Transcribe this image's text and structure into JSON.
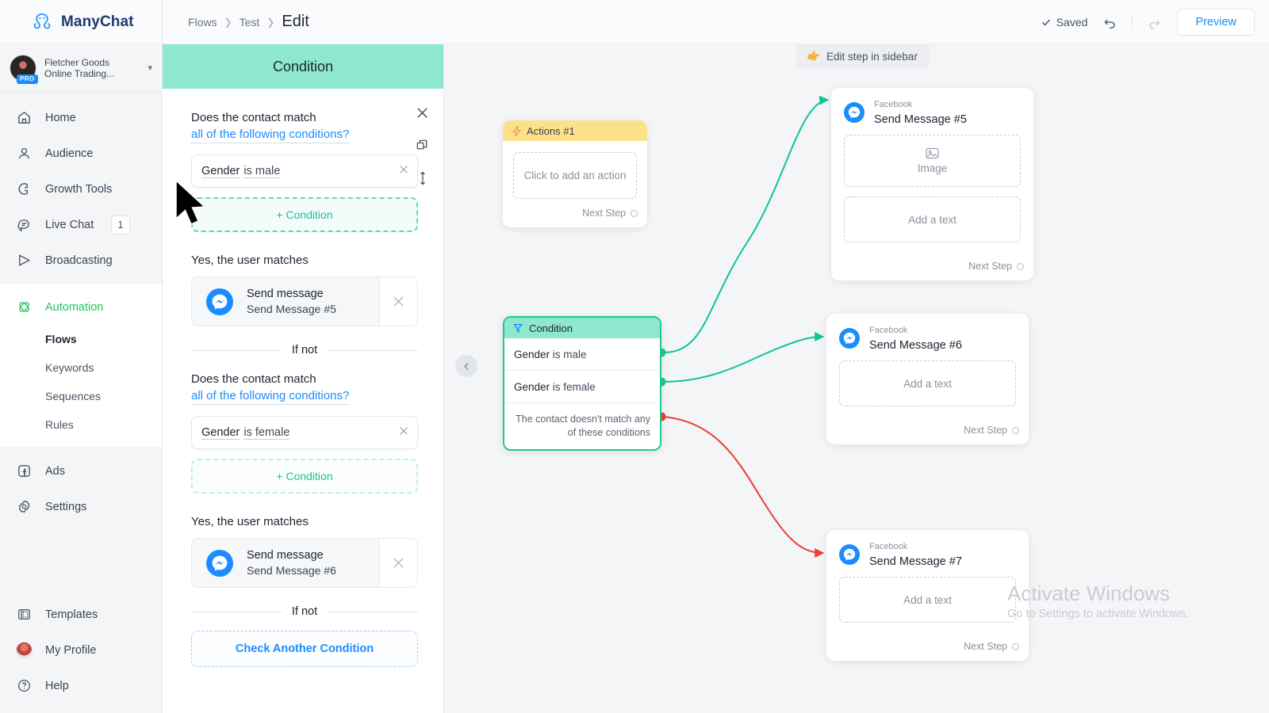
{
  "brand": {
    "name": "ManyChat",
    "logo_icon": "octopus-icon",
    "accent_blue": "#1a8cff",
    "accent_green": "#22c55e",
    "accent_teal": "#17c39a",
    "header_teal": "#8ee8cf",
    "red": "#e8413a"
  },
  "account": {
    "name": "Fletcher Goods",
    "subtitle": "Online Trading...",
    "badge": "PRO",
    "chevron_icon": "chevron-down-icon"
  },
  "sidebar": {
    "items": [
      {
        "label": "Home",
        "icon": "home-icon"
      },
      {
        "label": "Audience",
        "icon": "user-icon"
      },
      {
        "label": "Growth Tools",
        "icon": "magnet-icon"
      },
      {
        "label": "Live Chat",
        "icon": "chat-bubble-icon",
        "badge": "1"
      },
      {
        "label": "Broadcasting",
        "icon": "send-icon"
      }
    ],
    "automation": {
      "label": "Automation",
      "icon": "atom-icon"
    },
    "automation_sub": [
      {
        "label": "Flows",
        "active": true
      },
      {
        "label": "Keywords",
        "active": false
      },
      {
        "label": "Sequences",
        "active": false
      },
      {
        "label": "Rules",
        "active": false
      }
    ],
    "lower": [
      {
        "label": "Ads",
        "icon": "facebook-square-icon"
      },
      {
        "label": "Settings",
        "icon": "gear-icon"
      }
    ],
    "bottom": [
      {
        "label": "Templates",
        "icon": "templates-icon"
      },
      {
        "label": "My Profile",
        "icon": "profile-avatar-icon"
      },
      {
        "label": "Help",
        "icon": "question-circle-icon"
      }
    ]
  },
  "topbar": {
    "breadcrumbs": [
      {
        "label": "Flows"
      },
      {
        "label": "Test"
      }
    ],
    "current": "Edit",
    "saved_label": "Saved",
    "saved_icon": "checkmark-icon",
    "undo_icon": "undo-arrow-icon",
    "redo_icon": "redo-arrow-icon",
    "preview_label": "Preview"
  },
  "panel": {
    "title": "Condition",
    "tools": {
      "close_icon": "close-icon",
      "duplicate_icon": "duplicate-icon",
      "reorder_icon": "move-updown-icon"
    },
    "blocks": [
      {
        "question_line1": "Does the contact match",
        "question_line2": "all of the following conditions?",
        "condition": {
          "field": "Gender",
          "value": "is male",
          "remove_icon": "close-icon"
        },
        "add_condition_label": "+ Condition",
        "yes_label": "Yes, the user matches",
        "action": {
          "title": "Send message",
          "subtitle": "Send Message #5",
          "icon": "messenger-icon",
          "remove_icon": "close-icon"
        },
        "if_not_label": "If not"
      },
      {
        "question_line1": "Does the contact match",
        "question_line2": "all of the following conditions?",
        "condition": {
          "field": "Gender",
          "value": "is female",
          "remove_icon": "close-icon"
        },
        "add_condition_label": "+ Condition",
        "yes_label": "Yes, the user matches",
        "action": {
          "title": "Send message",
          "subtitle": "Send Message #6",
          "icon": "messenger-icon",
          "remove_icon": "close-icon"
        },
        "if_not_label": "If not"
      }
    ],
    "check_another_label": "Check Another Condition",
    "cursor_icon": "mouse-pointer-icon"
  },
  "canvas": {
    "edit_tip": {
      "icon": "pointing-hand-icon",
      "label": "Edit step in sidebar"
    },
    "collapse_icon": "chevron-left-icon",
    "next_step_label": "Next Step",
    "actions_node": {
      "title": "Actions #1",
      "icon": "lightning-bolt-icon",
      "placeholder": "Click to add an action"
    },
    "condition_node": {
      "title": "Condition",
      "icon": "filter-icon",
      "rows": [
        {
          "field": "Gender",
          "value": "is male"
        },
        {
          "field": "Gender",
          "value": "is female"
        }
      ],
      "fallback_line1": "The contact doesn't match any",
      "fallback_line2": "of these conditions"
    },
    "message_nodes": [
      {
        "channel": "Facebook",
        "name": "Send Message #5",
        "icon": "messenger-icon",
        "slots": [
          {
            "type": "image",
            "label": "Image",
            "icon": "image-icon"
          },
          {
            "type": "text",
            "label": "Add a text"
          }
        ]
      },
      {
        "channel": "Facebook",
        "name": "Send Message #6",
        "icon": "messenger-icon",
        "slots": [
          {
            "type": "text",
            "label": "Add a text"
          }
        ]
      },
      {
        "channel": "Facebook",
        "name": "Send Message #7",
        "icon": "messenger-icon",
        "slots": [
          {
            "type": "text",
            "label": "Add a text"
          }
        ]
      }
    ]
  },
  "watermark": {
    "line1": "Activate Windows",
    "line2": "Go to Settings to activate Windows."
  }
}
